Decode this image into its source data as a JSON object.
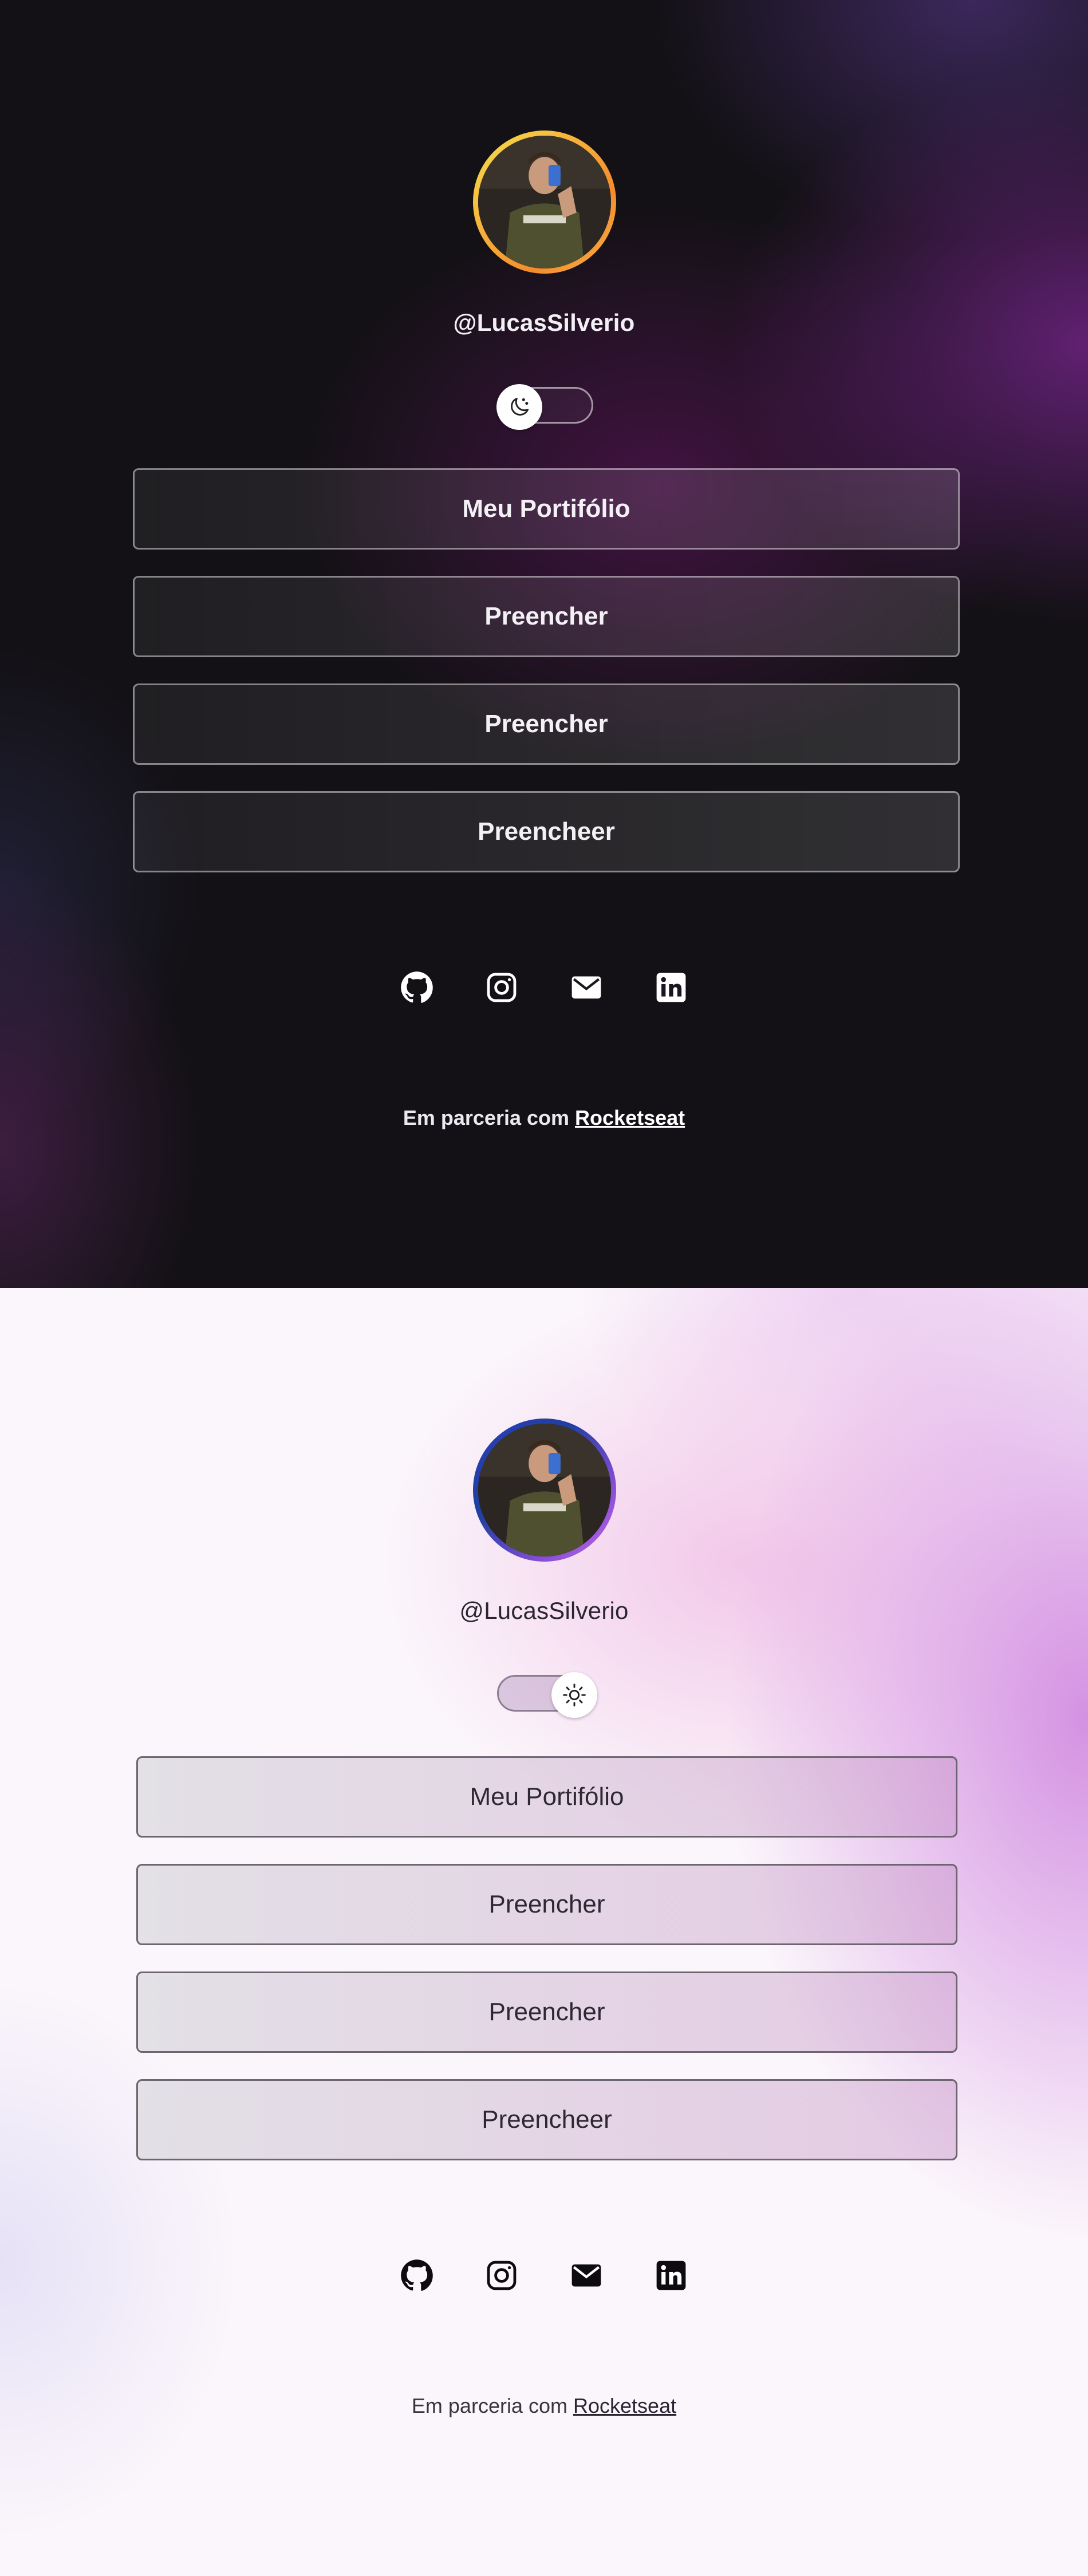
{
  "profile": {
    "handle": "@LucasSilverio"
  },
  "theme_toggle": {
    "dark_icon": "moon-icon",
    "light_icon": "sun-icon"
  },
  "links": [
    {
      "label": "Meu Portifólio"
    },
    {
      "label": "Preencher"
    },
    {
      "label": "Preencher"
    },
    {
      "label": "Preencheer"
    }
  ],
  "social": [
    {
      "icon": "github-icon"
    },
    {
      "icon": "instagram-icon"
    },
    {
      "icon": "mail-icon"
    },
    {
      "icon": "linkedin-icon"
    }
  ],
  "footer": {
    "prefix": "Em parceria com",
    "link": "Rocketseat"
  },
  "colors": {
    "dark_ring": "#f7b23b",
    "light_ring": "#2d3fb8",
    "dark_accent": "#6e2382",
    "light_accent": "#d28ce1"
  }
}
